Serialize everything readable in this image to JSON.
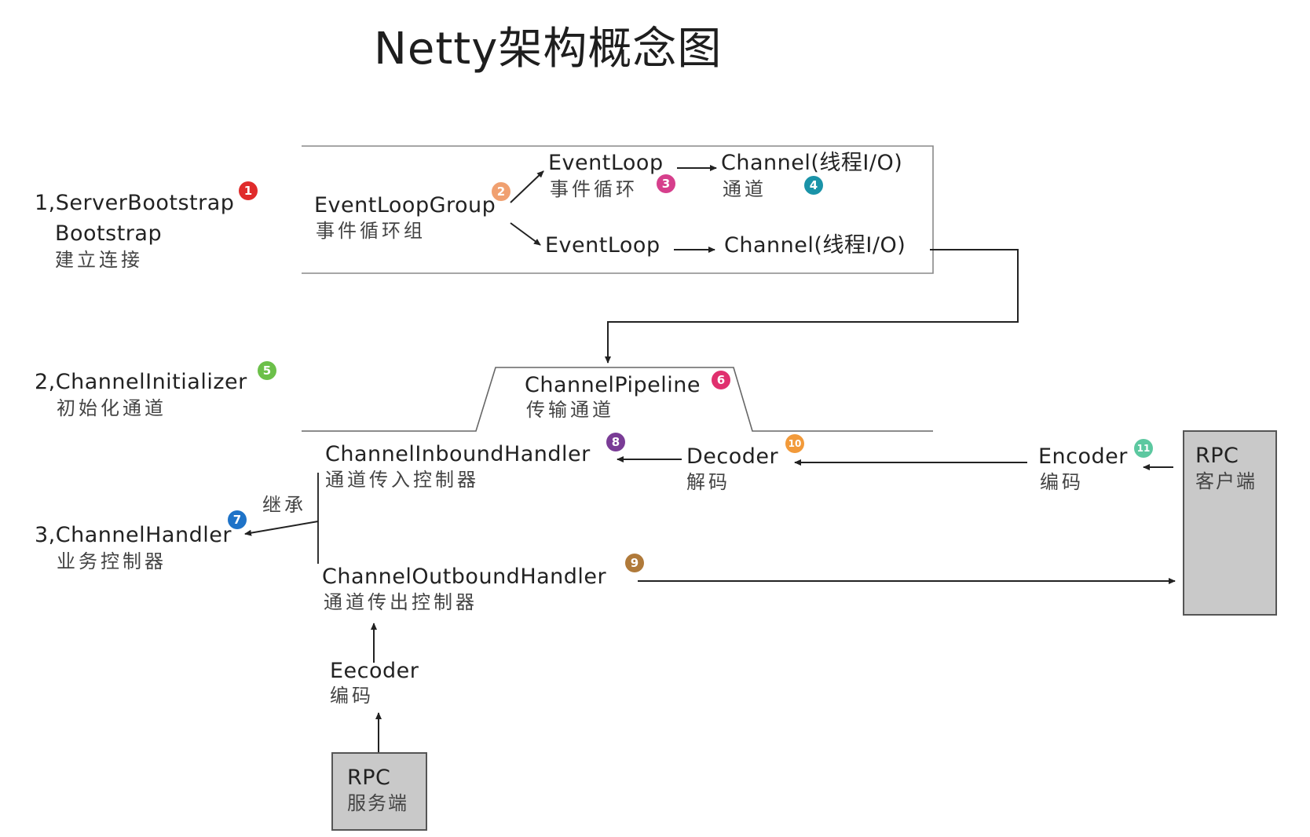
{
  "title": "Netty架构概念图",
  "left": {
    "server_bootstrap": {
      "line1": "1,ServerBootstrap",
      "line2": "Bootstrap",
      "zh": "建立连接",
      "badge": "1"
    },
    "channel_initializer": {
      "en": "2,ChannelInitializer",
      "zh": "初始化通道",
      "badge": "5"
    },
    "channel_handler": {
      "en": "3,ChannelHandler",
      "zh": "业务控制器",
      "badge": "7"
    },
    "inherit": "继承"
  },
  "event_group": {
    "group": {
      "en": "EventLoopGroup",
      "zh": "事件循环组",
      "badge": "2"
    },
    "loop_top": {
      "en": "EventLoop",
      "zh": "事件循环",
      "badge": "3"
    },
    "channel_top": {
      "en": "Channel(线程I/O)",
      "zh": "通道",
      "badge": "4"
    },
    "loop_bottom": {
      "en": "EventLoop"
    },
    "channel_bottom": {
      "en": "Channel(线程I/O)"
    }
  },
  "pipeline": {
    "en": "ChannelPipeline",
    "zh": "传输通道",
    "badge": "6"
  },
  "inbound": {
    "en": "ChannelInboundHandler",
    "zh": "通道传入控制器",
    "badge": "8"
  },
  "outbound": {
    "en": "ChannelOutboundHandler",
    "zh": "通道传出控制器",
    "badge": "9"
  },
  "decoder": {
    "en": "Decoder",
    "zh": "解码",
    "badge": "10"
  },
  "encoder_right": {
    "en": "Encoder",
    "zh": "编码",
    "badge": "11"
  },
  "encoder_bottom": {
    "en": "Eecoder",
    "zh": "编码"
  },
  "rpc_client": {
    "en": "RPC",
    "zh": "客户端"
  },
  "rpc_server": {
    "en": "RPC",
    "zh": "服务端"
  },
  "colors": {
    "badge1": "#e02b2b",
    "badge2": "#f0a070",
    "badge3": "#d63f8c",
    "badge4": "#1a93a8",
    "badge5": "#6cc04a",
    "badge6": "#e0306e",
    "badge7": "#1e73c8",
    "badge8": "#7a3c96",
    "badge9": "#b07a3a",
    "badge10": "#f29a3a",
    "badge11": "#5cc8a0"
  }
}
